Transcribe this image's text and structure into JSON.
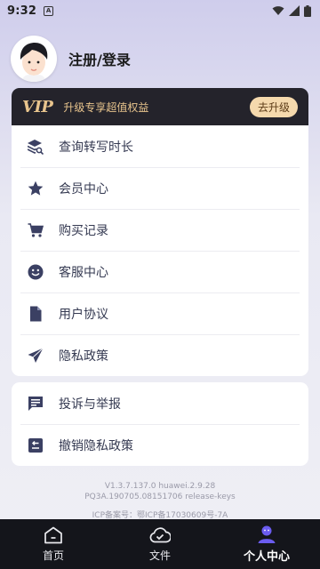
{
  "status_bar": {
    "time": "9:32",
    "notif_letter": "A"
  },
  "profile": {
    "name": "注册/登录"
  },
  "vip": {
    "logo": "VIP",
    "text": "升级专享超值权益",
    "upgrade_label": "去升级",
    "colors": {
      "banner": "#24232b",
      "gold": "#e8c48d",
      "button": "#f5d9ad"
    }
  },
  "menu_main": [
    {
      "label": "查询转写时长",
      "icon": "layers-search-icon"
    },
    {
      "label": "会员中心",
      "icon": "star-icon"
    },
    {
      "label": "购买记录",
      "icon": "cart-icon"
    },
    {
      "label": "客服中心",
      "icon": "smile-icon"
    },
    {
      "label": "用户协议",
      "icon": "document-icon"
    },
    {
      "label": "隐私政策",
      "icon": "send-icon"
    }
  ],
  "menu_secondary": [
    {
      "label": "投诉与举报",
      "icon": "message-icon"
    },
    {
      "label": "撤销隐私政策",
      "icon": "revoke-icon"
    }
  ],
  "version": {
    "line1": "V1.3.7.137.0  huawei.2.9.28",
    "line2": "PQ3A.190705.08151706 release-keys",
    "line3": "ICP备案号：鄂ICP备17030609号-7A"
  },
  "bottom_nav": [
    {
      "label": "首页",
      "icon": "home-icon"
    },
    {
      "label": "文件",
      "icon": "cloud-check-icon"
    },
    {
      "label": "个人中心",
      "icon": "person-icon",
      "active": true
    }
  ]
}
